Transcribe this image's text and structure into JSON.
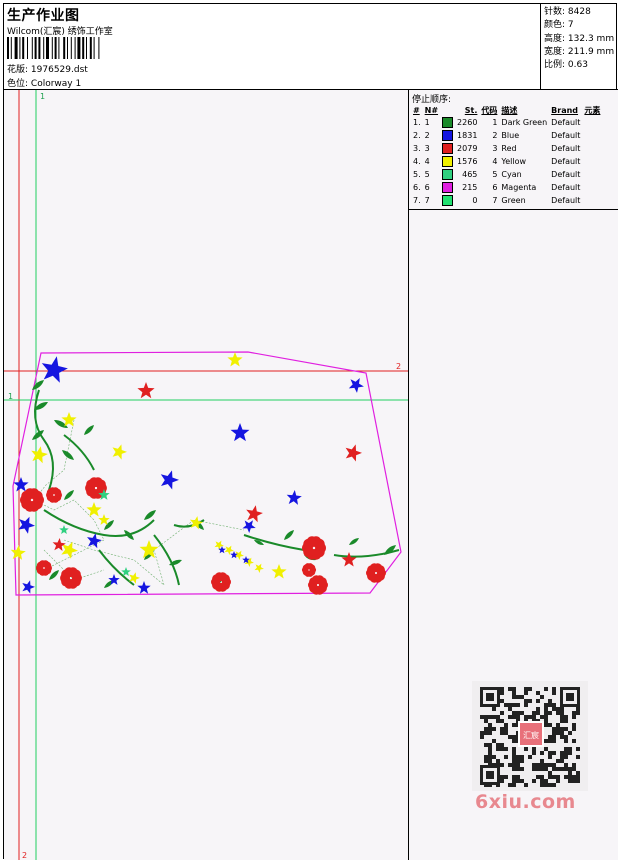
{
  "header": {
    "title": "生产作业图",
    "studio": "Wilcom(汇宸) 绣饰工作室",
    "pattern_label": "花版:",
    "pattern_value": "1976529.dst",
    "color_label": "色位:",
    "color_value": "Colorway 1"
  },
  "specs": [
    {
      "label": "针数:",
      "value": "8428"
    },
    {
      "label": "颜色:",
      "value": "7"
    },
    {
      "label": "高度:",
      "value": "132.3 mm"
    },
    {
      "label": "宽度:",
      "value": "211.9 mm"
    },
    {
      "label": "比例:",
      "value": "0.63"
    }
  ],
  "stop_order": {
    "title": "停止顺序:",
    "columns": [
      "#",
      "N#",
      "St.",
      "代码",
      "描述",
      "Brand",
      "元素"
    ],
    "rows": [
      {
        "idx": "1.",
        "n": "1",
        "color": "#1a8a2a",
        "st": "2260",
        "code": "1",
        "desc": "Dark Green",
        "brand": "Default"
      },
      {
        "idx": "2.",
        "n": "2",
        "color": "#1515e0",
        "st": "1831",
        "code": "2",
        "desc": "Blue",
        "brand": "Default"
      },
      {
        "idx": "3.",
        "n": "3",
        "color": "#e02020",
        "st": "2079",
        "code": "3",
        "desc": "Red",
        "brand": "Default"
      },
      {
        "idx": "4.",
        "n": "4",
        "color": "#f0f000",
        "st": "1576",
        "code": "4",
        "desc": "Yellow",
        "brand": "Default"
      },
      {
        "idx": "5.",
        "n": "5",
        "color": "#30d080",
        "st": "465",
        "code": "5",
        "desc": "Cyan",
        "brand": "Default"
      },
      {
        "idx": "6.",
        "n": "6",
        "color": "#e020e0",
        "st": "215",
        "code": "6",
        "desc": "Magenta",
        "brand": "Default"
      },
      {
        "idx": "7.",
        "n": "7",
        "color": "#20e070",
        "st": "0",
        "code": "7",
        "desc": "Green",
        "brand": "Default"
      }
    ]
  },
  "guides": {
    "vertical_label_top": "1",
    "vertical_label_bottom": "2",
    "horizontal_label_left": "1",
    "horizontal_label_right": "2"
  },
  "watermark": {
    "qr_text": "汇宸绣饰",
    "site": "6xiu.com"
  },
  "colors": {
    "dark_green": "#1a8a2a",
    "blue": "#1515e0",
    "red": "#e02020",
    "yellow": "#f0f000",
    "magenta": "#e020e0",
    "guide_red": "#e02020",
    "guide_green": "#20d060"
  }
}
